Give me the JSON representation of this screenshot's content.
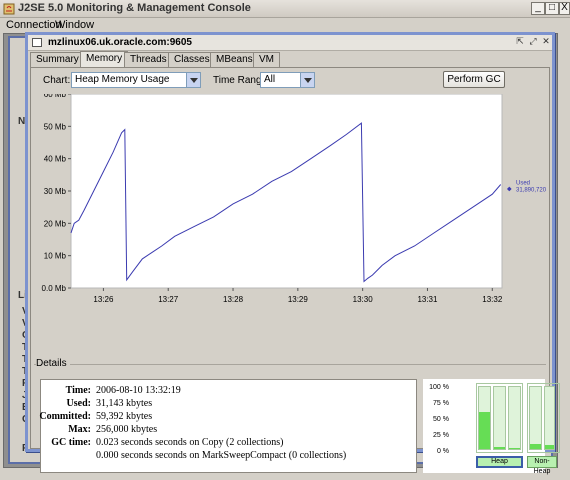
{
  "app": {
    "title": "J2SE 5.0 Monitoring & Management Console"
  },
  "menu": [
    "Connection",
    "Window"
  ],
  "window_buttons": [
    "_",
    "□",
    "X"
  ],
  "background_frame": {
    "labels": [
      "Nu",
      "Liv",
      "V",
      "V",
      "O",
      "T",
      "T",
      "T",
      "R",
      "J",
      "B",
      "C",
      "F"
    ]
  },
  "connection": {
    "title": "mzlinux06.uk.oracle.com:9605",
    "tabs": [
      "Summary",
      "Memory",
      "Threads",
      "Classes",
      "MBeans",
      "VM"
    ],
    "active_tab": "Memory"
  },
  "controls": {
    "chart_label": "Chart:",
    "chart_value": "Heap Memory Usage",
    "time_range_label": "Time Range:",
    "time_range_value": "All",
    "gc_button": "Perform GC"
  },
  "chart_data": {
    "type": "line",
    "title": "",
    "xlabel": "",
    "ylabel": "",
    "y_ticks": [
      "60 Mb",
      "50 Mb",
      "40 Mb",
      "30 Mb",
      "20 Mb",
      "10 Mb",
      "0.0 Mb"
    ],
    "x_ticks": [
      "13:26",
      "13:27",
      "13:28",
      "13:29",
      "13:30",
      "13:31",
      "13:32"
    ],
    "xlim_minutes": [
      25.5,
      32.15
    ],
    "ylim": [
      0,
      60
    ],
    "line_color": "#3b3bb0",
    "series": [
      {
        "name": "Used",
        "current_value": "31,890,720",
        "x_minutes": [
          25.5,
          25.55,
          25.62,
          25.7,
          25.85,
          26.0,
          26.15,
          26.28,
          26.33,
          26.36,
          26.45,
          26.6,
          26.75,
          26.9,
          27.1,
          27.4,
          27.7,
          28.0,
          28.3,
          28.6,
          28.9,
          29.2,
          29.5,
          29.75,
          29.98,
          30.02,
          30.08,
          30.15,
          30.3,
          30.5,
          30.8,
          31.1,
          31.4,
          31.7,
          32.0,
          32.13
        ],
        "y_mb": [
          17,
          20,
          21,
          24,
          30,
          36,
          42,
          48,
          49,
          2.5,
          5,
          9,
          11,
          13,
          16,
          19,
          22,
          26,
          29,
          33,
          36,
          40,
          44,
          47.5,
          51,
          2,
          3,
          4,
          7,
          10,
          13,
          17,
          21,
          25,
          29,
          32
        ]
      }
    ],
    "grid": false,
    "legend": "right"
  },
  "details": {
    "legend": "Details",
    "rows": [
      {
        "key": "Time:",
        "value": "2006-08-10 13:32:19"
      },
      {
        "key": "Used:",
        "value": "31,143 kbytes"
      },
      {
        "key": "Committed:",
        "value": "59,392 kbytes"
      },
      {
        "key": "Max:",
        "value": "256,000 kbytes"
      },
      {
        "key": "GC time:",
        "value": "0.023  seconds seconds on Copy (2 collections)"
      },
      {
        "key": "",
        "value": "0.000  seconds seconds on MarkSweepCompact (0 collections)"
      }
    ]
  },
  "pools": {
    "percent_labels": [
      "100 %",
      "75 %",
      "50 %",
      "25 %",
      "0 %"
    ],
    "heap_fill": [
      0.6,
      0.04,
      0.02
    ],
    "nonheap_fill": [
      0.08,
      0.06
    ],
    "heap_label": "Heap",
    "nonheap_label": "Non-Heap"
  }
}
